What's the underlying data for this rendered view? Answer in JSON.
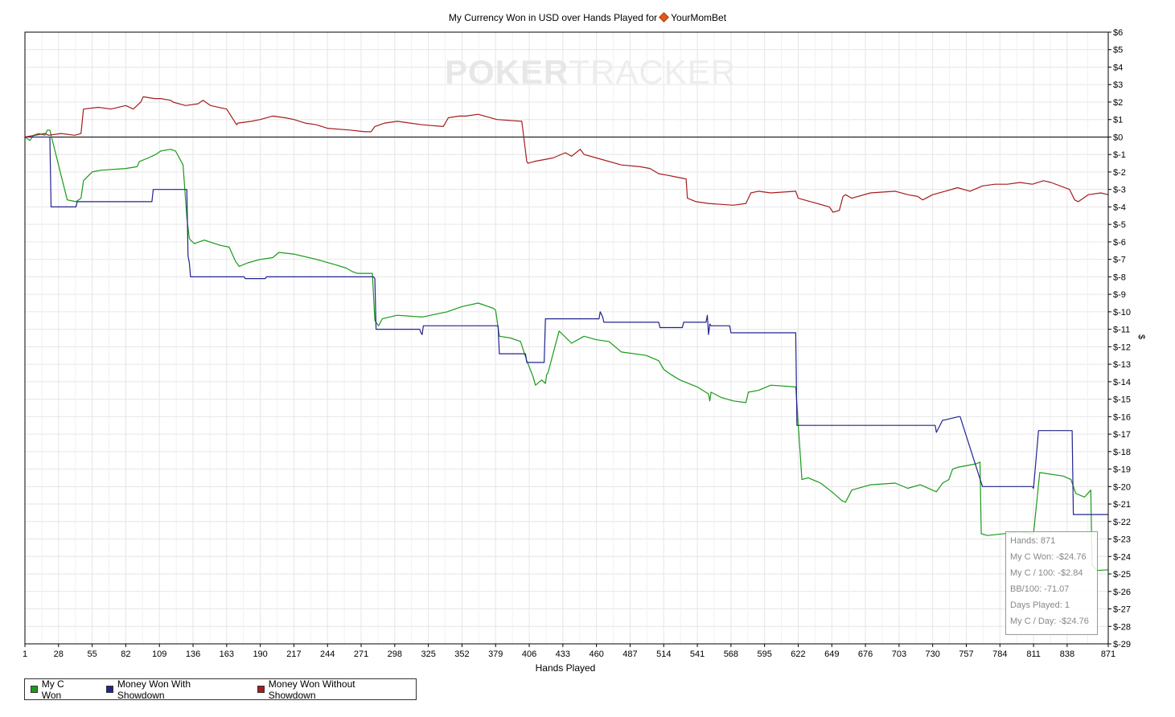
{
  "chart_title": "My Currency Won in USD over Hands Played for",
  "site_name": "YourMomBet",
  "watermark_a": "POKER",
  "watermark_b": "TRACKER",
  "legend": [
    {
      "label": "My C Won",
      "color": "#1a9a1a"
    },
    {
      "label": "Money Won With Showdown",
      "color": "#23238f"
    },
    {
      "label": "Money Won Without Showdown",
      "color": "#a51d1d"
    }
  ],
  "info": {
    "hands": "Hands: 871",
    "won": "My C Won: -$24.76",
    "per100": "My C / 100: -$2.84",
    "bb100": "BB/100: -71.07",
    "days": "Days Played: 1",
    "perday": "My C / Day: -$24.76"
  },
  "chart_data": {
    "type": "line",
    "title": "My Currency Won in USD over Hands Played for YourMomBet",
    "xlabel": "Hands Played",
    "ylabel": "$",
    "xlim": [
      1,
      871
    ],
    "ylim": [
      -29,
      6
    ],
    "x_ticks": [
      1,
      28,
      55,
      82,
      109,
      136,
      163,
      190,
      217,
      244,
      271,
      298,
      325,
      352,
      379,
      406,
      433,
      460,
      487,
      514,
      541,
      568,
      595,
      622,
      649,
      676,
      703,
      730,
      757,
      784,
      811,
      838,
      871
    ],
    "y_ticks": [
      "$6",
      "$5",
      "$4",
      "$3",
      "$2",
      "$1",
      "$0",
      "$-1",
      "$-2",
      "$-3",
      "$-4",
      "$-5",
      "$-6",
      "$-7",
      "$-8",
      "$-9",
      "$-10",
      "$-11",
      "$-12",
      "$-13",
      "$-14",
      "$-15",
      "$-16",
      "$-17",
      "$-18",
      "$-19",
      "$-20",
      "$-21",
      "$-22",
      "$-23",
      "$-24",
      "$-25",
      "$-26",
      "$-27",
      "$-28",
      "$-29"
    ],
    "grid": true,
    "legend_position": "bottom-left",
    "series": [
      {
        "name": "My C Won",
        "color": "#1a9a1a",
        "x": [
          1,
          5,
          8,
          12,
          17,
          19,
          21,
          22,
          35,
          42,
          46,
          48,
          55,
          62,
          82,
          91,
          93,
          100,
          106,
          110,
          118,
          122,
          128,
          131,
          133,
          134,
          137,
          145,
          158,
          165,
          170,
          173,
          180,
          190,
          200,
          205,
          217,
          235,
          250,
          259,
          264,
          268,
          280,
          282,
          285,
          288,
          300,
          320,
          340,
          352,
          365,
          377,
          379,
          382,
          391,
          399,
          404,
          409,
          411,
          416,
          419,
          420,
          421,
          430,
          440,
          450,
          460,
          470,
          480,
          500,
          510,
          514,
          520,
          527,
          541,
          550,
          551,
          552,
          560,
          570,
          580,
          582,
          590,
          600,
          620,
          625,
          630,
          640,
          649,
          657,
          660,
          665,
          680,
          700,
          710,
          720,
          733,
          738,
          743,
          746,
          750,
          765,
          768,
          769,
          774,
          800,
          811,
          816,
          835,
          841,
          845,
          852,
          857,
          858,
          862,
          871
        ],
        "y": [
          0,
          -0.2,
          0.1,
          0.2,
          0.1,
          0.4,
          0.4,
          0.1,
          -3.6,
          -3.7,
          -3.5,
          -2.5,
          -2,
          -1.9,
          -1.8,
          -1.7,
          -1.4,
          -1.2,
          -1,
          -0.8,
          -0.7,
          -0.8,
          -1.6,
          -4.6,
          -5.8,
          -5.9,
          -6.1,
          -5.9,
          -6.2,
          -6.3,
          -7.1,
          -7.4,
          -7.2,
          -7,
          -6.9,
          -6.6,
          -6.7,
          -7,
          -7.3,
          -7.5,
          -7.7,
          -7.8,
          -7.8,
          -10.5,
          -10.8,
          -10.4,
          -10.2,
          -10.3,
          -10,
          -9.7,
          -9.5,
          -9.8,
          -9.9,
          -11.4,
          -11.5,
          -11.7,
          -12.8,
          -13.7,
          -14.2,
          -13.9,
          -14.1,
          -13.6,
          -13.5,
          -11.1,
          -11.8,
          -11.4,
          -11.6,
          -11.7,
          -12.3,
          -12.5,
          -12.8,
          -13.3,
          -13.6,
          -13.9,
          -14.3,
          -14.7,
          -15.1,
          -14.6,
          -14.9,
          -15.1,
          -15.2,
          -14.6,
          -14.5,
          -14.2,
          -14.3,
          -19.6,
          -19.5,
          -19.8,
          -20.3,
          -20.8,
          -20.9,
          -20.2,
          -19.9,
          -19.8,
          -20.1,
          -19.9,
          -20.3,
          -19.8,
          -19.6,
          -19,
          -18.9,
          -18.7,
          -18.6,
          -22.7,
          -22.8,
          -22.6,
          -22.7,
          -19.2,
          -19.4,
          -19.6,
          -20.4,
          -20.6,
          -20.2,
          -24.5,
          -24.8,
          -24.76
        ]
      },
      {
        "name": "Money Won With Showdown",
        "color": "#23238f",
        "x": [
          1,
          21,
          22,
          42,
          43,
          103,
          104,
          131,
          132,
          133,
          134,
          177,
          178,
          194,
          195,
          281,
          282,
          283,
          318,
          319,
          320,
          321,
          381,
          382,
          403,
          404,
          418,
          419,
          435,
          462,
          463,
          465,
          466,
          510,
          511,
          529,
          530,
          548,
          549,
          550,
          551,
          552,
          567,
          568,
          620,
          621,
          732,
          733,
          738,
          739,
          751,
          752,
          770,
          771,
          810,
          811,
          815,
          816,
          842,
          843,
          862,
          871
        ],
        "y": [
          0,
          0,
          -4,
          -4,
          -3.7,
          -3.7,
          -3,
          -3,
          -6.8,
          -7.2,
          -8,
          -8,
          -8.1,
          -8.1,
          -8,
          -8,
          -8.1,
          -11,
          -11,
          -11.2,
          -11.3,
          -10.8,
          -10.8,
          -12.4,
          -12.4,
          -12.9,
          -12.9,
          -10.4,
          -10.4,
          -10.4,
          -10,
          -10.3,
          -10.6,
          -10.6,
          -10.9,
          -10.9,
          -10.6,
          -10.6,
          -10.2,
          -11.3,
          -10.7,
          -10.8,
          -10.8,
          -11.2,
          -11.2,
          -16.5,
          -16.5,
          -16.9,
          -16.2,
          -16.2,
          -16,
          -16,
          -20,
          -20,
          -20,
          -20.1,
          -16.8,
          -16.8,
          -16.8,
          -21.6,
          -21.6,
          -21.6
        ]
      },
      {
        "name": "Money Won Without Showdown",
        "color": "#a51d1d",
        "x": [
          1,
          17,
          20,
          30,
          41,
          46,
          48,
          60,
          70,
          82,
          88,
          94,
          96,
          105,
          110,
          118,
          120,
          130,
          140,
          144,
          150,
          163,
          171,
          172,
          183,
          190,
          200,
          210,
          217,
          226,
          235,
          244,
          262,
          274,
          279,
          282,
          290,
          300,
          320,
          337,
          341,
          350,
          355,
          365,
          380,
          400,
          404,
          405,
          410,
          425,
          435,
          440,
          447,
          450,
          460,
          480,
          495,
          503,
          510,
          518,
          525,
          532,
          533,
          540,
          550,
          570,
          580,
          584,
          590,
          600,
          620,
          622,
          632,
          647,
          650,
          655,
          658,
          660,
          665,
          680,
          700,
          710,
          718,
          722,
          730,
          740,
          750,
          760,
          770,
          780,
          790,
          800,
          810,
          819,
          825,
          840,
          844,
          847,
          855,
          865,
          871
        ],
        "y": [
          0,
          0.2,
          0.1,
          0.2,
          0.1,
          0.2,
          1.6,
          1.7,
          1.6,
          1.8,
          1.6,
          2,
          2.3,
          2.2,
          2.2,
          2.1,
          2,
          1.8,
          1.9,
          2.1,
          1.8,
          1.6,
          0.7,
          0.8,
          0.9,
          1,
          1.2,
          1.1,
          1,
          0.8,
          0.7,
          0.5,
          0.4,
          0.3,
          0.3,
          0.6,
          0.8,
          0.9,
          0.7,
          0.6,
          1.1,
          1.2,
          1.2,
          1.3,
          1,
          0.9,
          -1.4,
          -1.5,
          -1.4,
          -1.2,
          -0.9,
          -1.1,
          -0.7,
          -1,
          -1.2,
          -1.6,
          -1.7,
          -1.8,
          -2.1,
          -2.2,
          -2.3,
          -2.4,
          -3.5,
          -3.7,
          -3.8,
          -3.9,
          -3.8,
          -3.2,
          -3.1,
          -3.2,
          -3.1,
          -3.5,
          -3.7,
          -4,
          -4.3,
          -4.2,
          -3.4,
          -3.3,
          -3.5,
          -3.2,
          -3.1,
          -3.3,
          -3.4,
          -3.6,
          -3.3,
          -3.1,
          -2.9,
          -3.1,
          -2.8,
          -2.7,
          -2.7,
          -2.6,
          -2.7,
          -2.5,
          -2.6,
          -3,
          -3.6,
          -3.7,
          -3.3,
          -3.2,
          -3.3
        ]
      }
    ]
  }
}
